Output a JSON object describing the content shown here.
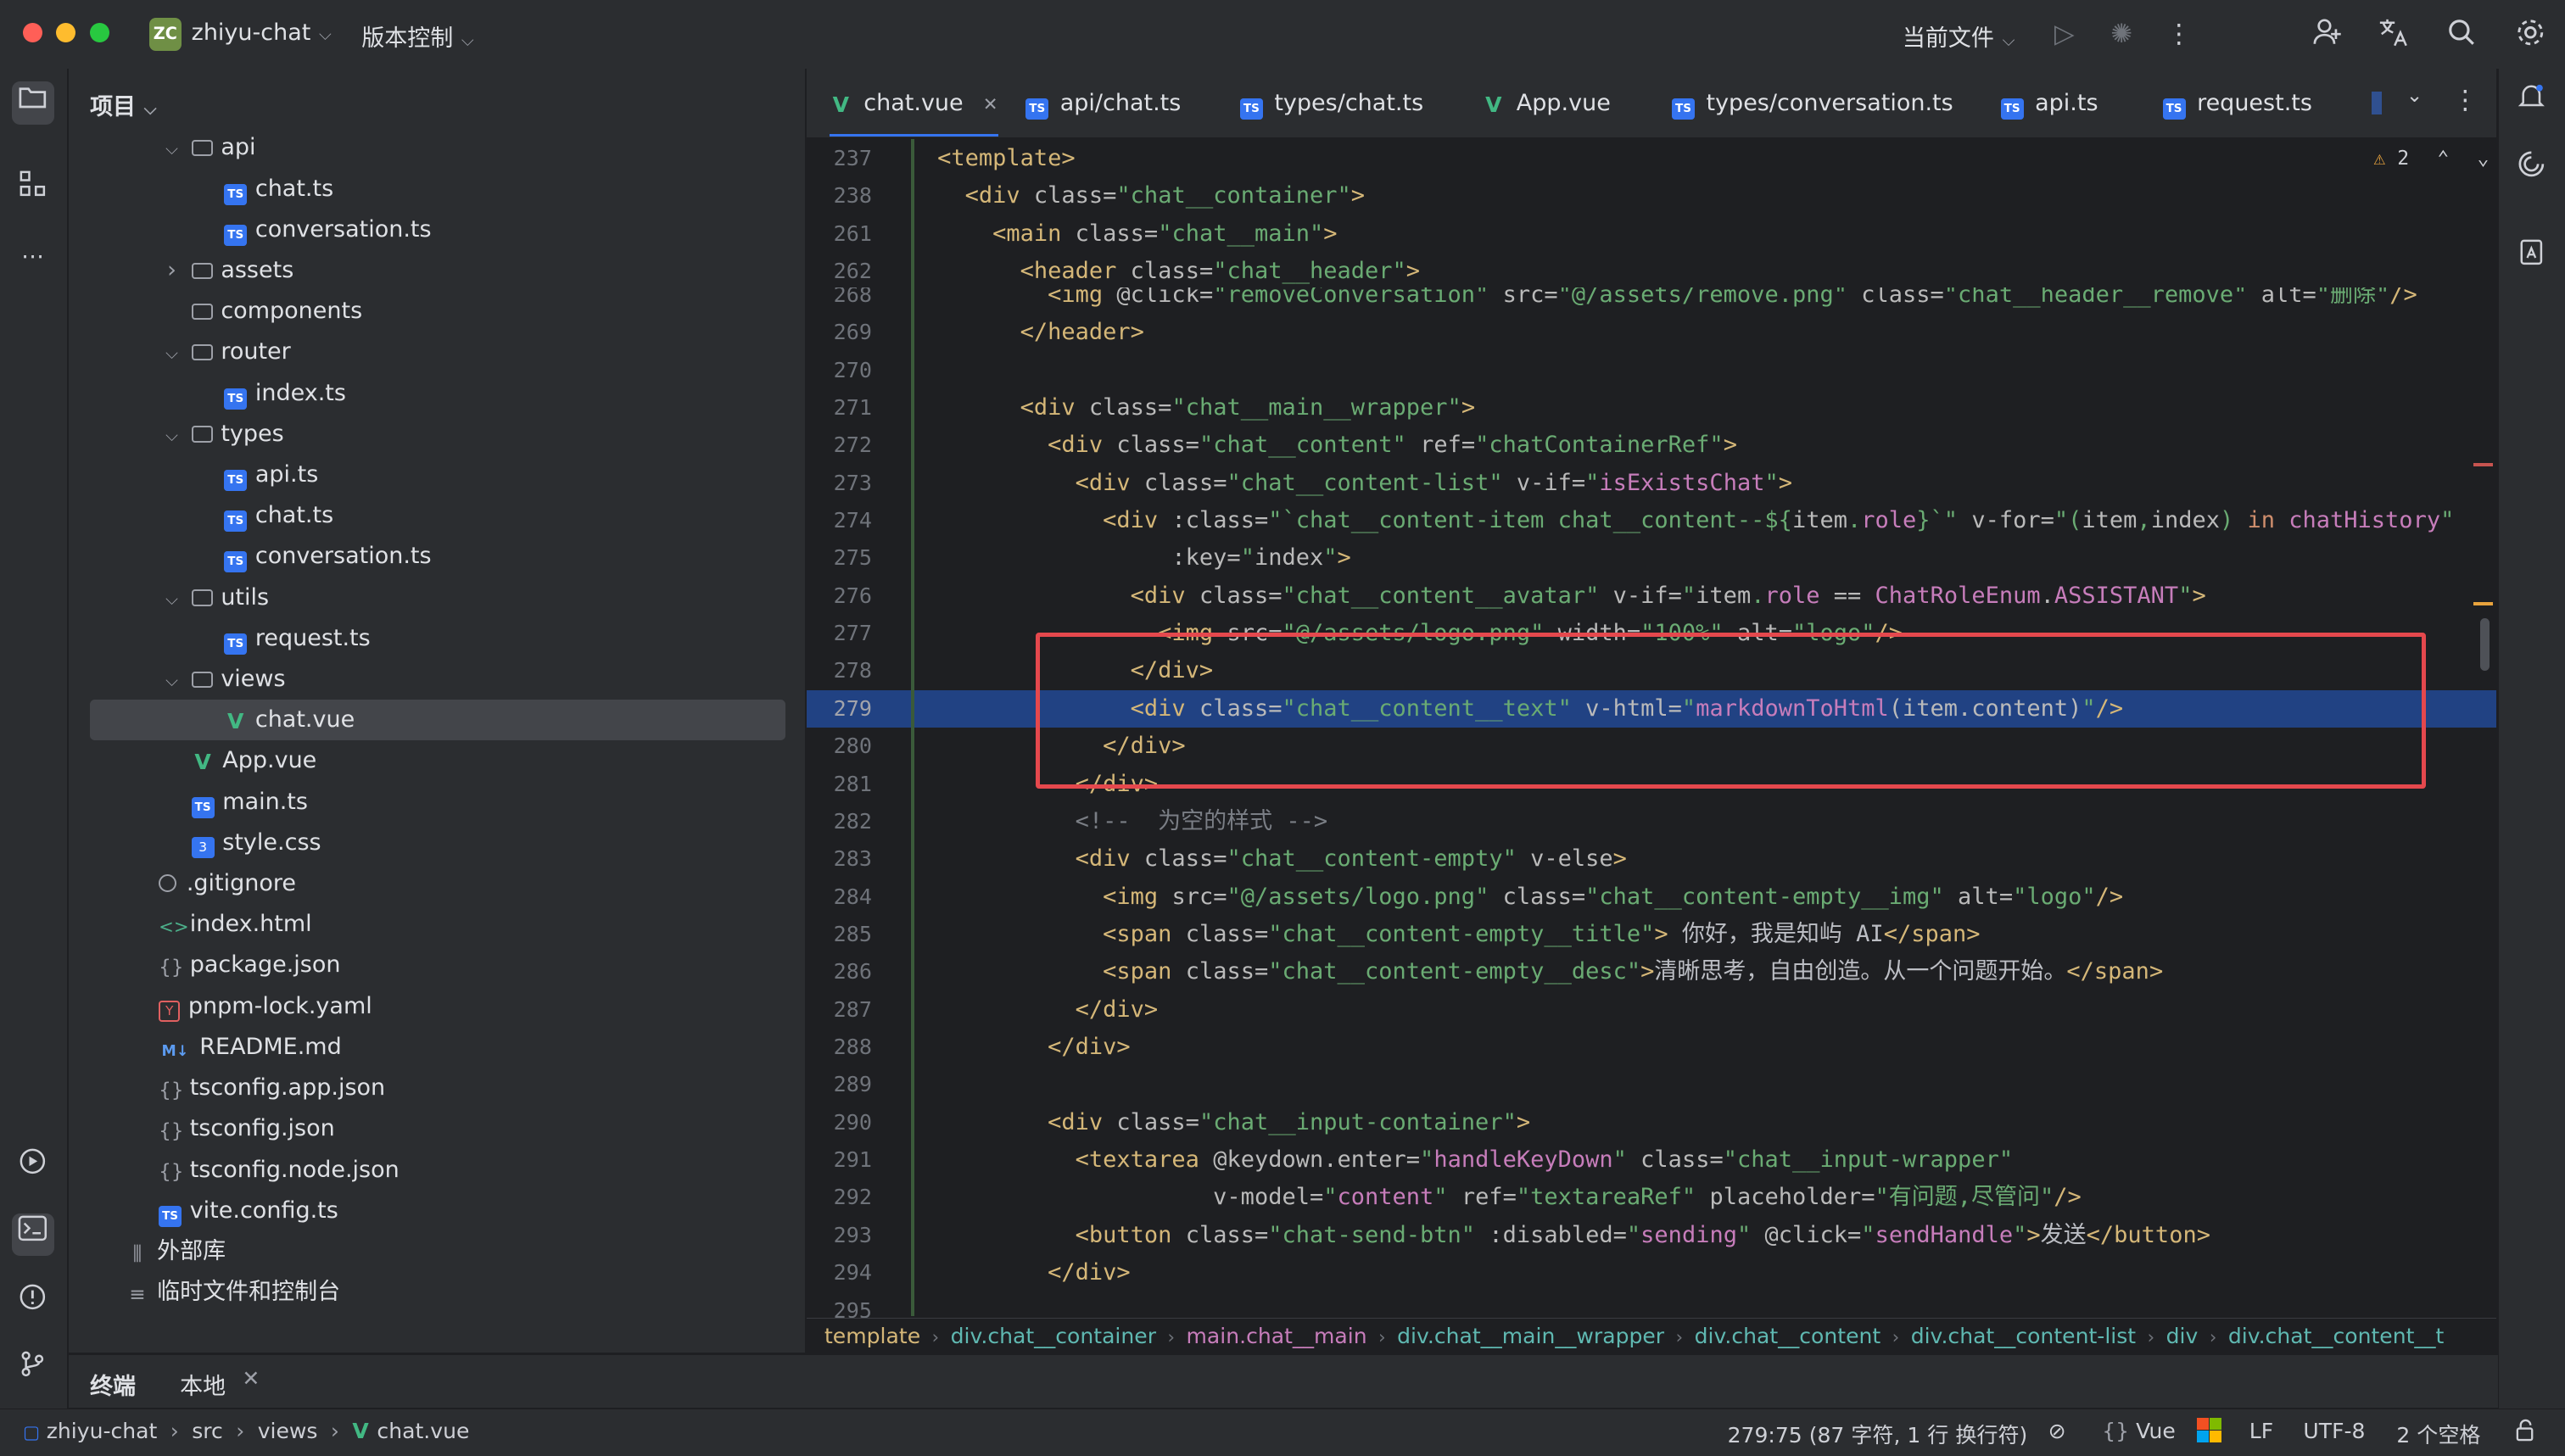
{
  "titlebar": {
    "project_badge": "ZC",
    "project_name": "zhiyu-chat",
    "vcs_menu": "版本控制",
    "run_config": "当前文件"
  },
  "project_panel": {
    "title": "项目",
    "tree": [
      {
        "label": "api",
        "type": "folder",
        "indent": 1,
        "expanded": true
      },
      {
        "label": "chat.ts",
        "type": "ts",
        "indent": 2
      },
      {
        "label": "conversation.ts",
        "type": "ts",
        "indent": 2
      },
      {
        "label": "assets",
        "type": "folder",
        "indent": 1,
        "expanded": false
      },
      {
        "label": "components",
        "type": "folder",
        "indent": 1,
        "noarrow": true
      },
      {
        "label": "router",
        "type": "folder",
        "indent": 1,
        "expanded": true
      },
      {
        "label": "index.ts",
        "type": "ts",
        "indent": 2
      },
      {
        "label": "types",
        "type": "folder",
        "indent": 1,
        "expanded": true
      },
      {
        "label": "api.ts",
        "type": "ts",
        "indent": 2
      },
      {
        "label": "chat.ts",
        "type": "ts",
        "indent": 2
      },
      {
        "label": "conversation.ts",
        "type": "ts",
        "indent": 2
      },
      {
        "label": "utils",
        "type": "folder",
        "indent": 1,
        "expanded": true
      },
      {
        "label": "request.ts",
        "type": "ts",
        "indent": 2
      },
      {
        "label": "views",
        "type": "folder",
        "indent": 1,
        "expanded": true
      },
      {
        "label": "chat.vue",
        "type": "vue",
        "indent": 2,
        "selected": true
      },
      {
        "label": "App.vue",
        "type": "vue",
        "indent": 1
      },
      {
        "label": "main.ts",
        "type": "ts",
        "indent": 1
      },
      {
        "label": "style.css",
        "type": "css",
        "indent": 1
      },
      {
        "label": ".gitignore",
        "type": "git",
        "indent": 0
      },
      {
        "label": "index.html",
        "type": "html",
        "indent": 0
      },
      {
        "label": "package.json",
        "type": "json",
        "indent": 0
      },
      {
        "label": "pnpm-lock.yaml",
        "type": "yaml",
        "indent": 0
      },
      {
        "label": "README.md",
        "type": "md",
        "indent": 0
      },
      {
        "label": "tsconfig.app.json",
        "type": "json",
        "indent": 0
      },
      {
        "label": "tsconfig.json",
        "type": "json",
        "indent": 0
      },
      {
        "label": "tsconfig.node.json",
        "type": "json",
        "indent": 0
      },
      {
        "label": "vite.config.ts",
        "type": "ts",
        "indent": 0
      },
      {
        "label": "外部库",
        "type": "lib",
        "indent": -1
      },
      {
        "label": "临时文件和控制台",
        "type": "scratch",
        "indent": -1
      }
    ]
  },
  "tabs": [
    {
      "label": "chat.vue",
      "type": "vue",
      "active": true
    },
    {
      "label": "api/chat.ts",
      "type": "ts"
    },
    {
      "label": "types/chat.ts",
      "type": "ts"
    },
    {
      "label": "App.vue",
      "type": "vue"
    },
    {
      "label": "types/conversation.ts",
      "type": "ts"
    },
    {
      "label": "api.ts",
      "type": "ts"
    },
    {
      "label": "request.ts",
      "type": "ts"
    }
  ],
  "inspections": {
    "warnings": "2"
  },
  "sticky_lines": [
    {
      "num": "237",
      "html": "<span class=\"t\">&lt;template&gt;</span>"
    },
    {
      "num": "238",
      "html": "  <span class=\"t\">&lt;div</span> <span class=\"a\">class=</span><span class=\"v\">\"chat__container\"</span><span class=\"t\">&gt;</span>"
    },
    {
      "num": "261",
      "html": "    <span class=\"t\">&lt;main</span> <span class=\"a\">class=</span><span class=\"v\">\"chat__main\"</span><span class=\"t\">&gt;</span>"
    },
    {
      "num": "262",
      "html": "      <span class=\"t\">&lt;header</span> <span class=\"a\">class=</span><span class=\"v\">\"chat__header\"</span><span class=\"t\">&gt;</span>"
    }
  ],
  "code_lines": [
    {
      "num": "268",
      "html": "        <span class=\"t\">&lt;img</span> <span class=\"a\">@click=</span><span class=\"v\">\"removeConversation\"</span> <span class=\"a\">src=</span><span class=\"v\">\"@/assets/remove.png\"</span> <span class=\"a\">class=</span><span class=\"v\">\"chat__header__remove\"</span> <span class=\"a\">alt=</span><span class=\"v\">\"删除\"</span><span class=\"t\">/&gt;</span>"
    },
    {
      "num": "269",
      "html": "      <span class=\"t\">&lt;/header&gt;</span>"
    },
    {
      "num": "270",
      "html": ""
    },
    {
      "num": "271",
      "html": "      <span class=\"t\">&lt;div</span> <span class=\"a\">class=</span><span class=\"v\">\"chat__main__wrapper\"</span><span class=\"t\">&gt;</span>"
    },
    {
      "num": "272",
      "html": "        <span class=\"t\">&lt;div</span> <span class=\"a\">class=</span><span class=\"v\">\"chat__content\"</span> <span class=\"a\">ref=</span><span class=\"v\">\"chatContainerRef\"</span><span class=\"t\">&gt;</span>"
    },
    {
      "num": "273",
      "html": "          <span class=\"t\">&lt;div</span> <span class=\"a\">class=</span><span class=\"v\">\"chat__content-list\"</span> <span class=\"a\">v-if=</span><span class=\"v\">\"</span><span class=\"i\">isExistsChat</span><span class=\"v\">\"</span><span class=\"t\">&gt;</span>"
    },
    {
      "num": "274",
      "html": "            <span class=\"t\">&lt;div</span> <span class=\"a\">:class=</span><span class=\"v\">\"`chat__content-item chat__content--${</span><span class=\"a\">item</span><span class=\"v\">.</span><span class=\"fld\">role</span><span class=\"v\">}`\"</span> <span class=\"a\">v-for=</span><span class=\"v\">\"(</span><span class=\"a\">item</span><span class=\"v\">,</span><span class=\"a\">index</span><span class=\"v\">) </span><span class=\"k\">in</span> <span class=\"i\">chatHistory</span><span class=\"v\">\"</span>"
    },
    {
      "num": "275",
      "html": "                 <span class=\"a\">:key=</span><span class=\"v\">\"</span><span class=\"a\">index</span><span class=\"v\">\"</span><span class=\"t\">&gt;</span>"
    },
    {
      "num": "276",
      "html": "              <span class=\"t\">&lt;div</span> <span class=\"a\">class=</span><span class=\"v\">\"chat__content__avatar\"</span> <span class=\"a\">v-if=</span><span class=\"v\">\"</span><span class=\"a\">item</span><span class=\"v\">.</span><span class=\"fld\">role</span> <span class=\"a\">==</span> <span class=\"i\">ChatRoleEnum</span><span class=\"a\">.</span><span class=\"i\">ASSISTANT</span><span class=\"v\">\"</span><span class=\"t\">&gt;</span>"
    },
    {
      "num": "277",
      "html": "                <span class=\"t\">&lt;img</span> <span class=\"a\">src=</span><span class=\"v\">\"@/assets/logo.png\"</span> <span class=\"a\">width=</span><span class=\"v\">\"100%\"</span> <span class=\"a\">alt=</span><span class=\"v\">\"logo\"</span><span class=\"t\">/&gt;</span>"
    },
    {
      "num": "278",
      "html": "              <span class=\"t\">&lt;/div&gt;</span>"
    },
    {
      "num": "279",
      "html": "              <span class=\"t\">&lt;div</span> <span class=\"a\">class=</span><span class=\"v\">\"chat__content__text\"</span> <span class=\"a\">v-html=</span><span class=\"v\">\"</span><span class=\"i\">markdownToHtml</span><span class=\"a\">(item.content)</span><span class=\"v\">\"</span><span class=\"t\">/&gt;</span>",
      "highlighted": true
    },
    {
      "num": "280",
      "html": "            <span class=\"t\">&lt;/div&gt;</span>"
    },
    {
      "num": "281",
      "html": "          <span class=\"t\">&lt;/div&gt;</span>"
    },
    {
      "num": "282",
      "html": "          <span class=\"c\">&lt;!--  为空的样式 --&gt;</span>"
    },
    {
      "num": "283",
      "html": "          <span class=\"t\">&lt;div</span> <span class=\"a\">class=</span><span class=\"v\">\"chat__content-empty\"</span> <span class=\"a\">v-else</span><span class=\"t\">&gt;</span>"
    },
    {
      "num": "284",
      "html": "            <span class=\"t\">&lt;img</span> <span class=\"a\">src=</span><span class=\"v\">\"@/assets/logo.png\"</span> <span class=\"a\">class=</span><span class=\"v\">\"chat__content-empty__img\"</span> <span class=\"a\">alt=</span><span class=\"v\">\"logo\"</span><span class=\"t\">/&gt;</span>"
    },
    {
      "num": "285",
      "html": "            <span class=\"t\">&lt;span</span> <span class=\"a\">class=</span><span class=\"v\">\"chat__content-empty__title\"</span><span class=\"t\">&gt;</span> 你好，我是知屿 AI<span class=\"t\">&lt;/span&gt;</span>"
    },
    {
      "num": "286",
      "html": "            <span class=\"t\">&lt;span</span> <span class=\"a\">class=</span><span class=\"v\">\"chat__content-empty__desc\"</span><span class=\"t\">&gt;</span>清晰思考，自由创造。从一个问题开始。<span class=\"t\">&lt;/span&gt;</span>"
    },
    {
      "num": "287",
      "html": "          <span class=\"t\">&lt;/div&gt;</span>"
    },
    {
      "num": "288",
      "html": "        <span class=\"t\">&lt;/div&gt;</span>"
    },
    {
      "num": "289",
      "html": ""
    },
    {
      "num": "290",
      "html": "        <span class=\"t\">&lt;div</span> <span class=\"a\">class=</span><span class=\"v\">\"chat__input-container\"</span><span class=\"t\">&gt;</span>"
    },
    {
      "num": "291",
      "html": "          <span class=\"t\">&lt;textarea</span> <span class=\"a\">@keydown.enter=</span><span class=\"v\">\"</span><span class=\"i\">handleKeyDown</span><span class=\"v\">\"</span> <span class=\"a\">class=</span><span class=\"v\">\"chat__input-wrapper\"</span>"
    },
    {
      "num": "292",
      "html": "                    <span class=\"a\">v-model=</span><span class=\"v\">\"</span><span class=\"i\">content</span><span class=\"v\">\"</span> <span class=\"a\">ref=</span><span class=\"v\">\"textareaRef\"</span> <span class=\"a\">placeholder=</span><span class=\"v\">\"有问题,尽管问\"</span><span class=\"t\">/&gt;</span>"
    },
    {
      "num": "293",
      "html": "          <span class=\"t\">&lt;button</span> <span class=\"a\">class=</span><span class=\"v\">\"chat-send-btn\"</span> <span class=\"a\">:disabled=</span><span class=\"v\">\"</span><span class=\"i\">sending</span><span class=\"v\">\"</span> <span class=\"a\">@click=</span><span class=\"v\">\"</span><span class=\"i\">sendHandle</span><span class=\"v\">\"</span><span class=\"t\">&gt;</span>发送<span class=\"t\">&lt;/button&gt;</span>"
    },
    {
      "num": "294",
      "html": "        <span class=\"t\">&lt;/div&gt;</span>"
    },
    {
      "num": "295",
      "html": ""
    }
  ],
  "breadcrumb": [
    "template",
    "div.chat__container",
    "main.chat__main",
    "div.chat__main__wrapper",
    "div.chat__content",
    "div.chat__content-list",
    "div",
    "div.chat__content__t"
  ],
  "bottom_tabs": {
    "terminal": "终端",
    "local": "本地"
  },
  "statusbar": {
    "path": [
      "zhiyu-chat",
      "src",
      "views",
      "chat.vue"
    ],
    "position": "279:75 (87 字符, 1 行 换行符)",
    "language": "Vue",
    "line_sep": "LF",
    "encoding": "UTF-8",
    "indent": "2 个空格"
  },
  "colors": {
    "accent": "#3574f0",
    "highlight_box": "#e5484d",
    "selected_line": "#214283"
  }
}
